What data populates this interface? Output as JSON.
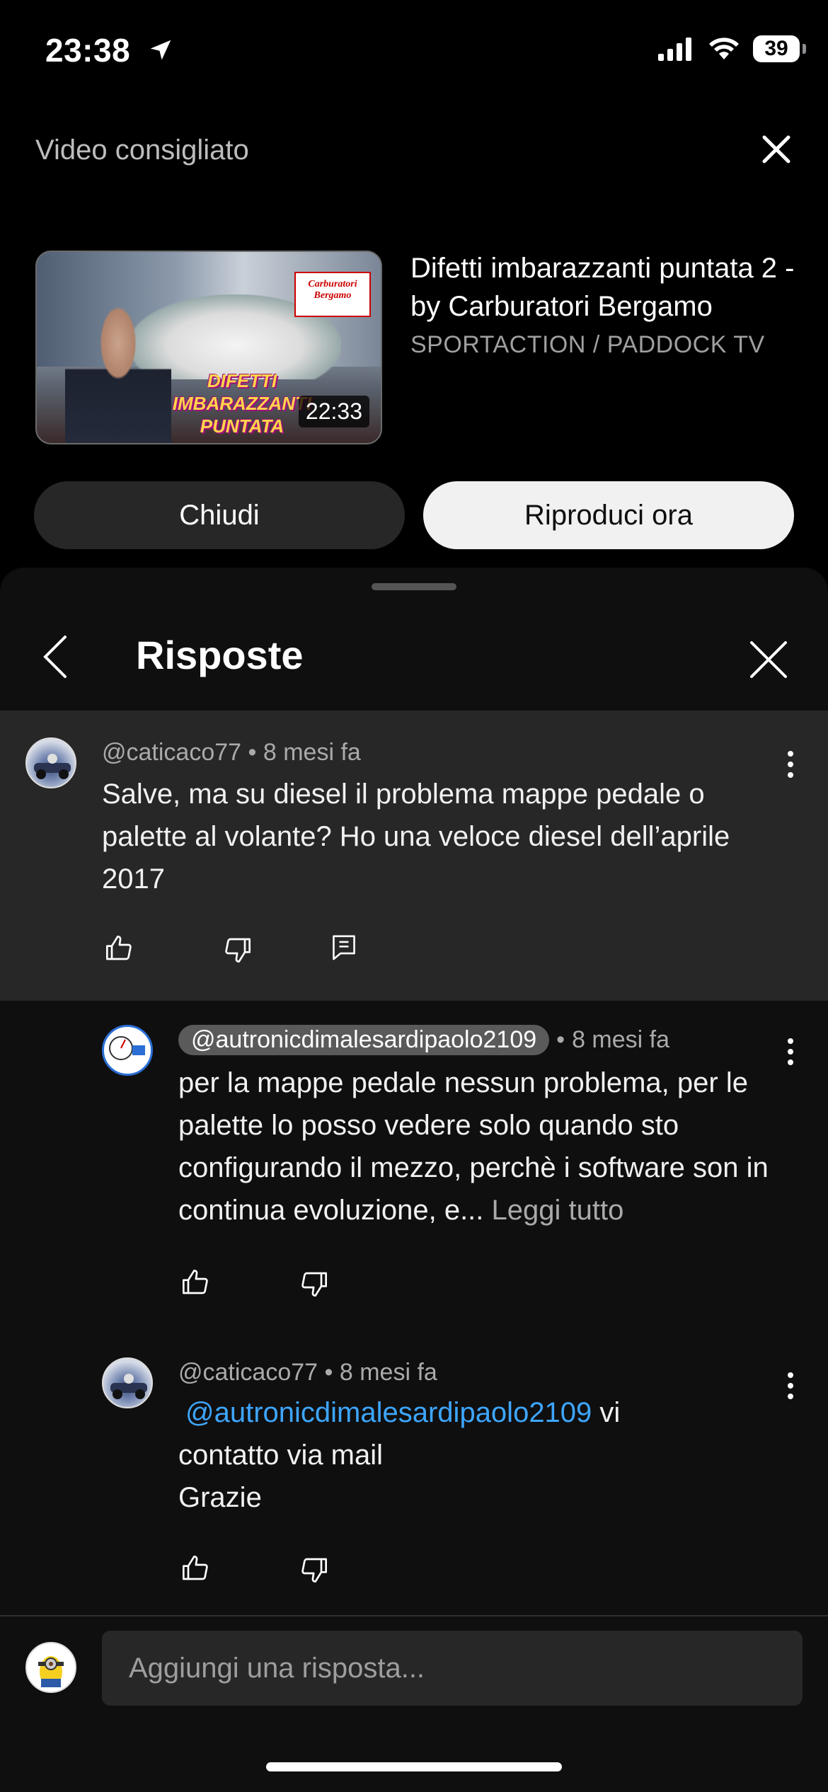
{
  "status_bar": {
    "time": "23:38",
    "battery": "39"
  },
  "recommended": {
    "header": "Video consigliato",
    "video": {
      "title": "Difetti imbarazzanti puntata 2 -  by Carburatori Bergamo",
      "channel": "SPORTACTION / PADDOCK TV",
      "duration": "22:33",
      "thumb_logo": "Carburatori Bergamo",
      "thumb_text": "DIFETTI IMBARAZZANTI PUNTATA"
    },
    "close_label": "Chiudi",
    "play_label": "Riproduci ora"
  },
  "sheet": {
    "title": "Risposte"
  },
  "parent_comment": {
    "author": "@caticaco77",
    "time": "8 mesi fa",
    "text": "Salve, ma su diesel il problema mappe pedale o palette al volante? Ho una veloce diesel dell’aprile 2017"
  },
  "replies": [
    {
      "author": "@autronicdimalesardipaolo2109",
      "time": "8 mesi fa",
      "text": "per la mappe pedale nessun problema, per le palette lo posso vedere solo quando sto configurando il mezzo, perchè i software son in continua evoluzione, e...",
      "read_more": "Leggi tutto"
    },
    {
      "author": "@caticaco77",
      "time": "8 mesi fa",
      "mention": "@autronicdimalesardipaolo2109",
      "text_after_mention": "vi",
      "text": "contatto via mail\nGrazie"
    }
  ],
  "composer": {
    "placeholder": "Aggiungi una risposta..."
  },
  "separator": "•"
}
